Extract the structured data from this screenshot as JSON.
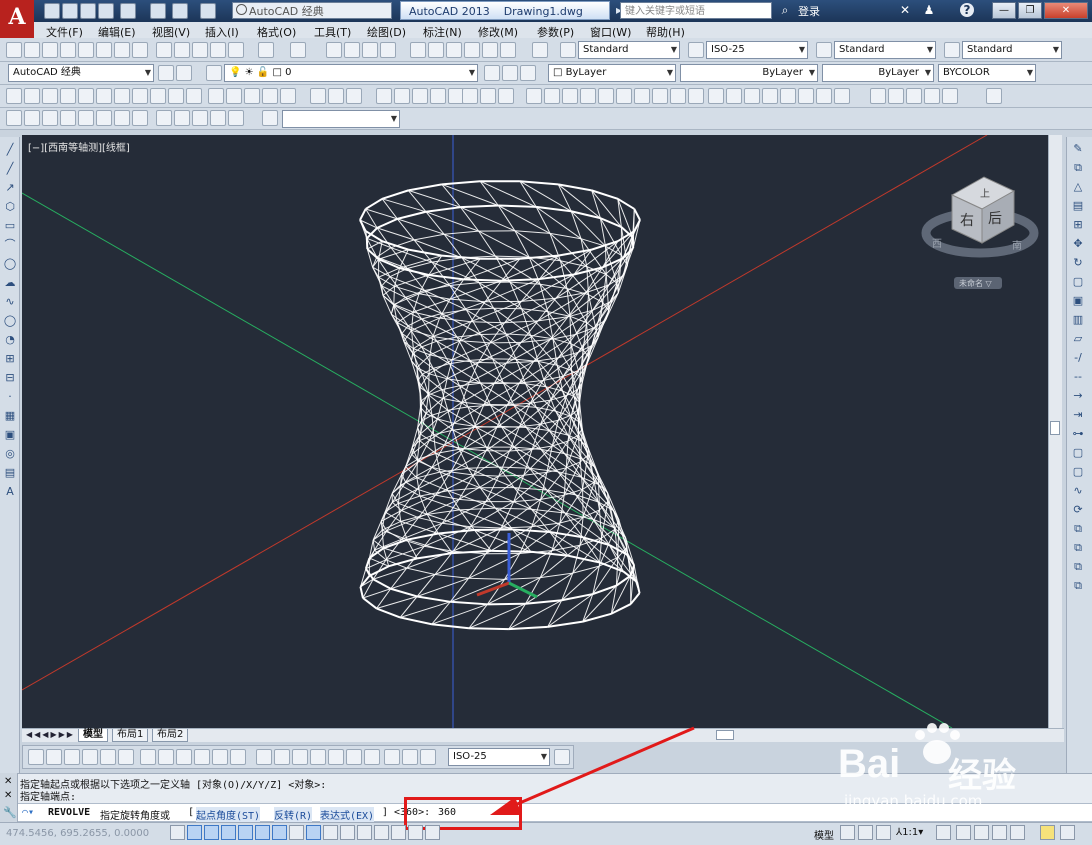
{
  "app": {
    "logo_letter": "A",
    "workspace": "AutoCAD 经典",
    "title": "AutoCAD 2013    Drawing1.dwg",
    "search_placeholder": "键入关键字或短语",
    "login_label": "登录",
    "help_label": "?"
  },
  "menu": [
    "文件(F)",
    "编辑(E)",
    "视图(V)",
    "插入(I)",
    "格式(O)",
    "工具(T)",
    "绘图(D)",
    "标注(N)",
    "修改(M)",
    "参数(P)",
    "窗口(W)",
    "帮助(H)"
  ],
  "styles_toolbar": {
    "text_style": "Standard",
    "dim_style": "ISO-25",
    "table_style": "Standard",
    "multileader_style": "Standard"
  },
  "layer_toolbar": {
    "workspace": "AutoCAD 经典",
    "layer": "0",
    "color": "ByLayer",
    "linetype": "ByLayer",
    "lineweight": "ByLayer",
    "plotstyle": "BYCOLOR"
  },
  "viewport": {
    "label": "[−][西南等轴测][线框]",
    "viewcube": {
      "top": "上",
      "front": "右",
      "side": "后",
      "west": "西",
      "south": "南",
      "unnamed": "未命名 ▽"
    }
  },
  "layout_tabs": [
    "模型",
    "布局1",
    "布局2"
  ],
  "dim_toolbar": {
    "dim_style": "ISO-25"
  },
  "command": {
    "history_1": "指定轴起点或根据以下选项之一定义轴 [对象(O)/X/Y/Z] <对象>:",
    "history_2": "指定轴端点:",
    "name": "REVOLVE",
    "prompt": "指定旋转角度或",
    "opt1": "起点角度(ST)",
    "opt2": "反转(R)",
    "opt3": "表达式(EX)",
    "default": "<360>:",
    "input_value": "360"
  },
  "status": {
    "coords": "474.5456, 695.2655, 0.0000",
    "model_label": "模型",
    "scale": "1:1"
  },
  "watermark": {
    "brand": "Bai",
    "brand_cn": "经验",
    "url": "jingyan.baidu.com"
  },
  "colors": {
    "viewport_bg": "#252c38",
    "wire": "#ffffff",
    "x_axis": "#c0392b",
    "y_axis": "#27ae60",
    "z_axis": "#3b5fd9",
    "annotation": "#e11a1a"
  }
}
